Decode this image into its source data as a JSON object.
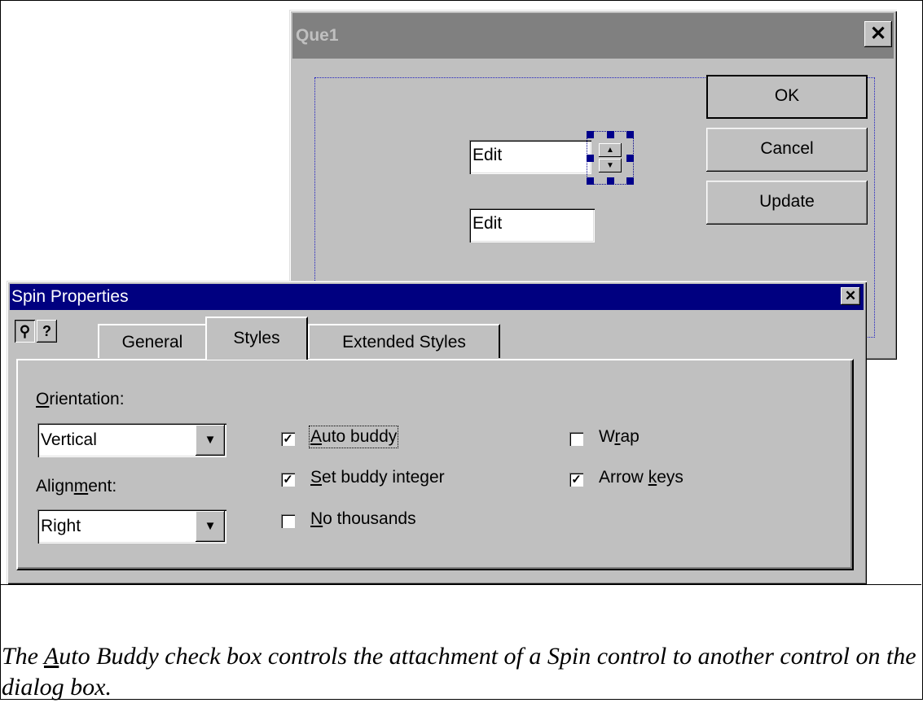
{
  "que_dialog": {
    "title": "Que1",
    "close_glyph": "✕",
    "buttons": {
      "ok": "OK",
      "cancel": "Cancel",
      "update": "Update"
    },
    "edit1": "Edit",
    "edit2": "Edit",
    "spin_up": "▲",
    "spin_down": "▼"
  },
  "spin_properties": {
    "title": "Spin Properties",
    "close_glyph": "✕",
    "pin_icon": "⚲",
    "help_icon": "?",
    "tabs": [
      {
        "label": "General"
      },
      {
        "label": "Styles",
        "active": true
      },
      {
        "label": "Extended Styles"
      }
    ],
    "orientation_label_prefix": "",
    "orientation_label_ul": "O",
    "orientation_label_rest": "rientation:",
    "orientation_value": "Vertical",
    "alignment_label_a": "Align",
    "alignment_label_ul": "m",
    "alignment_label_b": "ent:",
    "alignment_value": "Right",
    "combo_arrow": "▼",
    "checkboxes": {
      "auto_buddy": {
        "ul": "A",
        "rest": "uto buddy",
        "checked": true,
        "mark": "✓"
      },
      "set_buddy_integer": {
        "ul": "S",
        "rest": "et buddy integer",
        "checked": true,
        "mark": "✓"
      },
      "no_thousands": {
        "ul": "N",
        "rest": "o thousands",
        "checked": false,
        "mark": ""
      },
      "wrap": {
        "a": "W",
        "ul": "r",
        "b": "ap",
        "checked": false,
        "mark": ""
      },
      "arrow_keys": {
        "a": "Arrow ",
        "ul": "k",
        "b": "eys",
        "checked": true,
        "mark": "✓"
      }
    }
  },
  "caption": {
    "pre": "The ",
    "ul": "A",
    "post": "uto Buddy check box controls the attachment of a Spin control to another control on the dialog box."
  }
}
